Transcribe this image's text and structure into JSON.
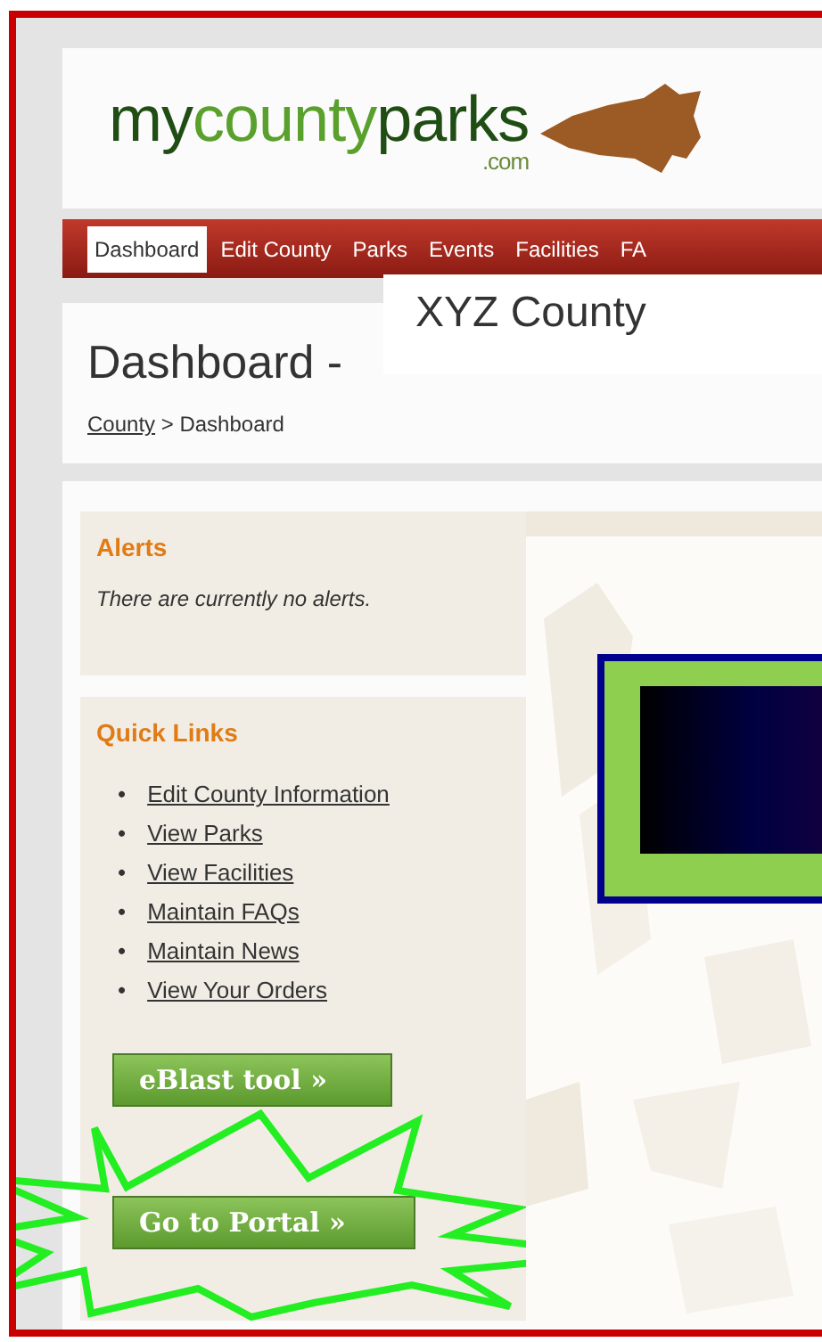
{
  "logo": {
    "parts": [
      "my",
      "county",
      "parks"
    ],
    "suffix": ".com"
  },
  "nav": [
    {
      "label": "Dashboard",
      "selected": true
    },
    {
      "label": "Edit County",
      "selected": false
    },
    {
      "label": "Parks",
      "selected": false
    },
    {
      "label": "Events",
      "selected": false
    },
    {
      "label": "Facilities",
      "selected": false
    },
    {
      "label": "FA",
      "selected": false
    }
  ],
  "page_title": "Dashboard -",
  "title_overlay": "XYZ County",
  "breadcrumb": {
    "link": "County",
    "rest": "> Dashboard"
  },
  "alerts": {
    "heading": "Alerts",
    "message": "There are currently no alerts."
  },
  "quick_links": {
    "heading": "Quick Links",
    "bullet": "•",
    "links": [
      "Edit County Information",
      "View Parks",
      "View Facilities",
      "Maintain FAQs",
      "Maintain News",
      "View Your Orders"
    ]
  },
  "buttons": [
    {
      "label": "eBlast tool »",
      "highlighted": false
    },
    {
      "label": "Go to Portal »",
      "highlighted": true
    }
  ]
}
